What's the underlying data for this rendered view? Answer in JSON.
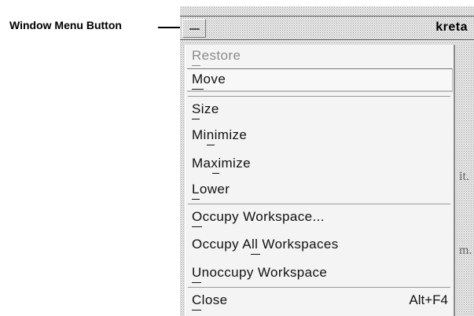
{
  "callout": {
    "label": "Window Menu Button"
  },
  "window": {
    "title_fragment": "kreta",
    "background_fragments": [
      "it.",
      "m."
    ]
  },
  "menu": {
    "items": [
      {
        "label": "Restore",
        "mnemonic": "R",
        "enabled": false,
        "accelerator": ""
      },
      {
        "label": "Move",
        "mnemonic": "M",
        "enabled": true,
        "accelerator": "",
        "highlighted": true
      },
      {
        "label": "Size",
        "mnemonic": "S",
        "enabled": true,
        "accelerator": ""
      },
      {
        "label": "Minimize",
        "mnemonic": "n",
        "enabled": true,
        "accelerator": ""
      },
      {
        "label": "Maximize",
        "mnemonic": "x",
        "enabled": true,
        "accelerator": ""
      },
      {
        "label": "Lower",
        "mnemonic": "L",
        "enabled": true,
        "accelerator": ""
      },
      {
        "label": "Occupy Workspace...",
        "mnemonic": "O",
        "enabled": true,
        "accelerator": ""
      },
      {
        "label": "Occupy All Workspaces",
        "mnemonic": "A",
        "enabled": true,
        "accelerator": ""
      },
      {
        "label": "Unoccupy Workspace",
        "mnemonic": "U",
        "enabled": true,
        "accelerator": ""
      },
      {
        "label": "Close",
        "mnemonic": "C",
        "enabled": true,
        "accelerator": "Alt+F4"
      }
    ]
  }
}
